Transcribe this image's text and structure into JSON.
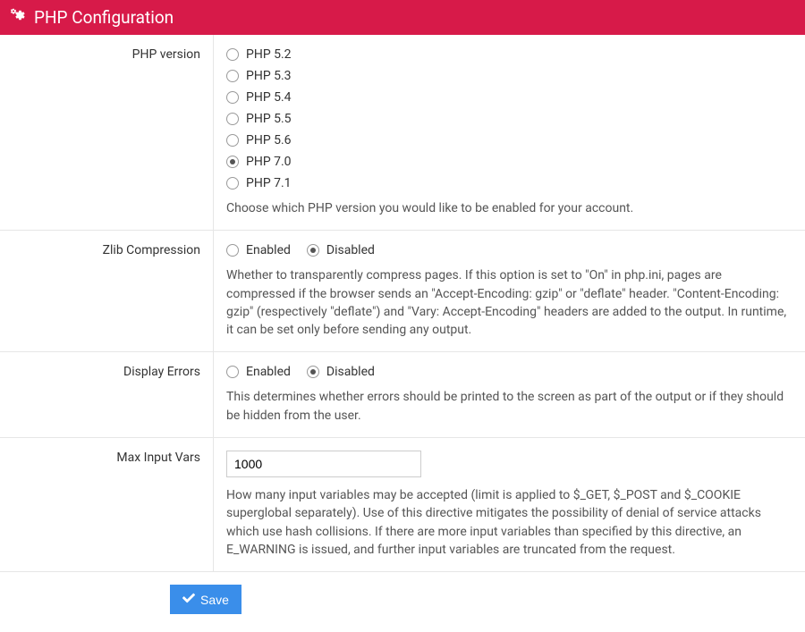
{
  "header": {
    "title": "PHP Configuration"
  },
  "phpVersion": {
    "label": "PHP version",
    "options": [
      {
        "label": "PHP 5.2",
        "checked": false
      },
      {
        "label": "PHP 5.3",
        "checked": false
      },
      {
        "label": "PHP 5.4",
        "checked": false
      },
      {
        "label": "PHP 5.5",
        "checked": false
      },
      {
        "label": "PHP 5.6",
        "checked": false
      },
      {
        "label": "PHP 7.0",
        "checked": true
      },
      {
        "label": "PHP 7.1",
        "checked": false
      }
    ],
    "help": "Choose which PHP version you would like to be enabled for your account."
  },
  "zlib": {
    "label": "Zlib Compression",
    "enabledLabel": "Enabled",
    "disabledLabel": "Disabled",
    "selected": "disabled",
    "help": "Whether to transparently compress pages. If this option is set to \"On\" in php.ini, pages are compressed if the browser sends an \"Accept-Encoding: gzip\" or \"deflate\" header. \"Content-Encoding: gzip\" (respectively \"deflate\") and \"Vary: Accept-Encoding\" headers are added to the output. In runtime, it can be set only before sending any output."
  },
  "displayErrors": {
    "label": "Display Errors",
    "enabledLabel": "Enabled",
    "disabledLabel": "Disabled",
    "selected": "disabled",
    "help": "This determines whether errors should be printed to the screen as part of the output or if they should be hidden from the user."
  },
  "maxInputVars": {
    "label": "Max Input Vars",
    "value": "1000",
    "help": "How many input variables may be accepted (limit is applied to $_GET, $_POST and $_COOKIE superglobal separately). Use of this directive mitigates the possibility of denial of service attacks which use hash collisions. If there are more input variables than specified by this directive, an E_WARNING is issued, and further input variables are truncated from the request."
  },
  "actions": {
    "saveLabel": "Save"
  }
}
